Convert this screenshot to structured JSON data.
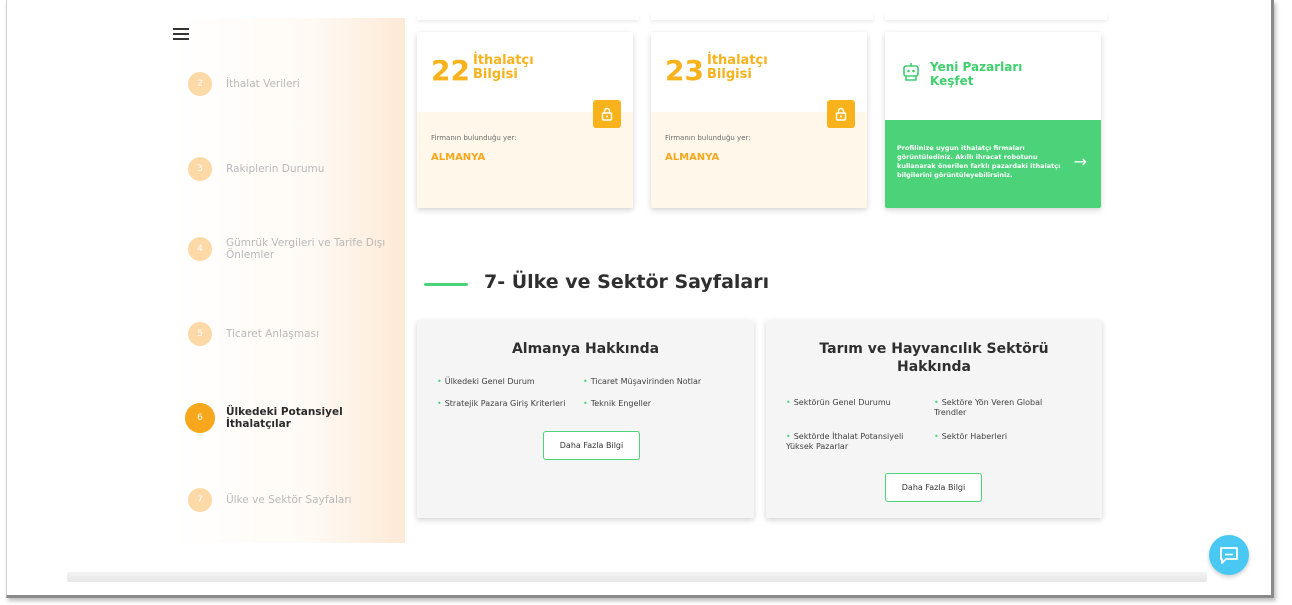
{
  "sidebar": {
    "items": [
      {
        "num": "2",
        "label": "İthalat Verileri"
      },
      {
        "num": "3",
        "label": "Rakiplerin Durumu"
      },
      {
        "num": "4",
        "label": "Gümrük Vergileri ve Tarife Dışı Önlemler"
      },
      {
        "num": "5",
        "label": "Ticaret Anlaşması"
      },
      {
        "num": "6",
        "label": "Ülkedeki Potansiyel İthalatçılar"
      },
      {
        "num": "7",
        "label": "Ülke ve Sektör Sayfaları"
      }
    ],
    "active_index": 4
  },
  "importer_cards": [
    {
      "number": "22",
      "label": "İthalatçı Bilgisi",
      "location_label": "Firmanın bulunduğu yer:",
      "location_value": "ALMANYA"
    },
    {
      "number": "23",
      "label": "İthalatçı Bilgisi",
      "location_label": "Firmanın bulunduğu yer:",
      "location_value": "ALMANYA"
    }
  ],
  "discover_card": {
    "title": "Yeni Pazarları Keşfet",
    "text": "Profilinize uygun ithalatçı firmaları görüntülediniz. Akıllı ihracat robotunu kullanarak önerilen farklı pazardaki ithalatçı bilgilerini görüntüleyebilirsiniz.",
    "arrow": "→"
  },
  "section": {
    "title": "7- Ülke ve Sektör Sayfaları"
  },
  "country_card": {
    "title": "Almanya Hakkında",
    "bullets": [
      "Ülkedeki Genel Durum",
      "Ticaret Müşavirinden Notlar",
      "Stratejik Pazara Giriş Kriterleri",
      "Teknik Engeller"
    ],
    "button": "Daha Fazla Bilgi"
  },
  "sector_card": {
    "title": "Tarım ve Hayvancılık Sektörü Hakkında",
    "bullets": [
      "Sektörün Genel Durumu",
      "Sektöre Yön Veren Global Trendler",
      "Sektörde İthalat Potansiyeli Yüksek Pazarlar",
      "Sektör Haberleri"
    ],
    "button": "Daha Fazla Bilgi"
  },
  "colors": {
    "accent_orange": "#f7b21c",
    "accent_green": "#4cd37a",
    "chat_blue": "#48c8f2"
  },
  "icons": {
    "menu": "hamburger-icon",
    "lock": "lock-icon",
    "robot": "robot-icon",
    "chat": "chat-icon"
  }
}
